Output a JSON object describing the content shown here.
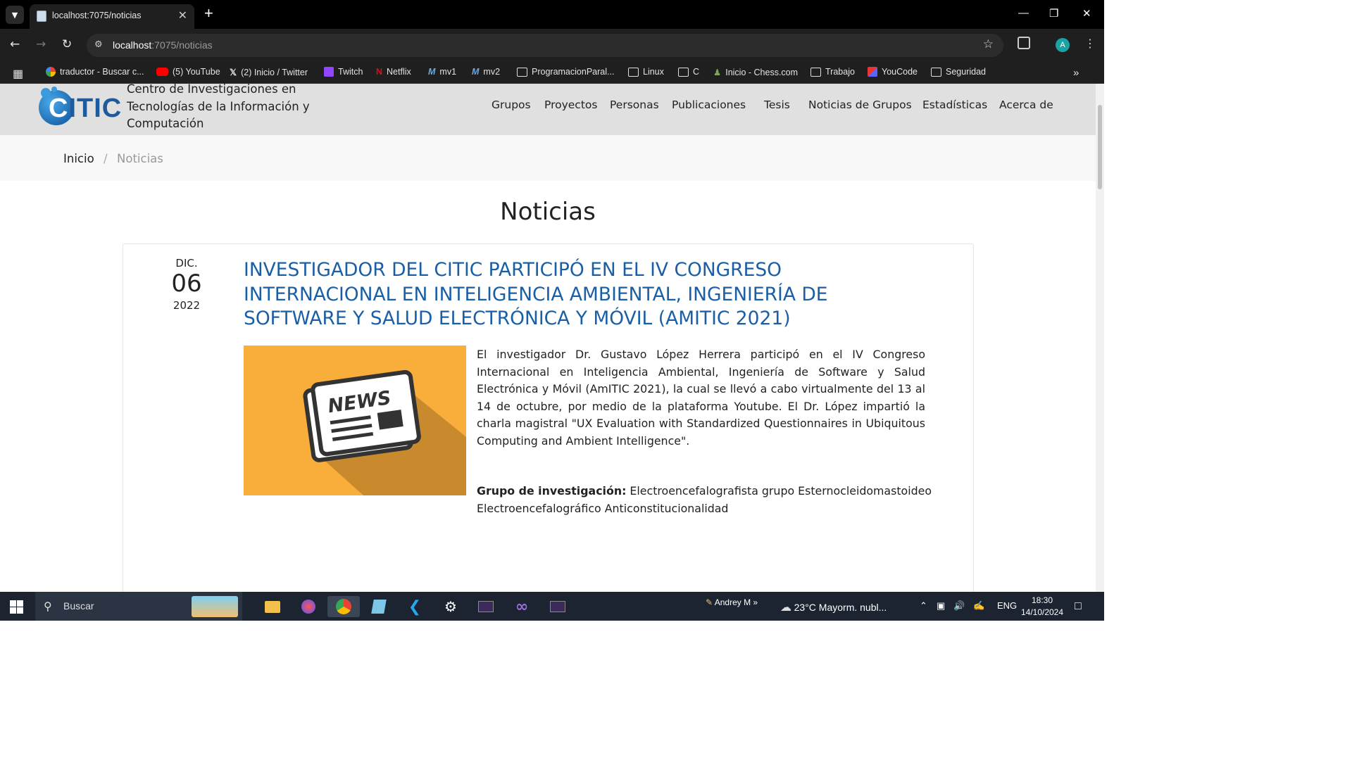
{
  "browser": {
    "tab_title": "localhost:7075/noticias",
    "url_host": "localhost",
    "url_rest": ":7075/noticias",
    "profile_initial": "A",
    "bookmarks": [
      {
        "label": "traductor - Buscar c...",
        "icon": "google-icon"
      },
      {
        "label": "(5) YouTube",
        "icon": "youtube-icon"
      },
      {
        "label": "(2) Inicio / Twitter",
        "icon": "x-icon"
      },
      {
        "label": "Twitch",
        "icon": "twitch-icon"
      },
      {
        "label": "Netflix",
        "icon": "netflix-icon"
      },
      {
        "label": "mv1",
        "icon": "m-icon"
      },
      {
        "label": "mv2",
        "icon": "m-icon"
      },
      {
        "label": "ProgramacionParal...",
        "icon": "folder-icon"
      },
      {
        "label": "Linux",
        "icon": "folder-icon"
      },
      {
        "label": "C",
        "icon": "folder-icon"
      },
      {
        "label": "Inicio - Chess.com",
        "icon": "chess-icon"
      },
      {
        "label": "Trabajo",
        "icon": "folder-icon"
      },
      {
        "label": "YouCode",
        "icon": "youcode-icon"
      },
      {
        "label": "Seguridad",
        "icon": "folder-icon"
      }
    ]
  },
  "site": {
    "logo_text_first": "C",
    "logo_text_rest": "ITIC",
    "org_name": "Centro de Investigaciones en Tecnologías de la Información y Computación",
    "menu": [
      "Grupos",
      "Proyectos",
      "Personas",
      "Publicaciones",
      "Tesis",
      "Noticias de Grupos",
      "Estadísticas",
      "Acerca de"
    ],
    "breadcrumb": {
      "home": "Inicio",
      "separator": "/",
      "current": "Noticias"
    },
    "page_title": "Noticias"
  },
  "news": {
    "month": "DIC.",
    "day": "06",
    "year": "2022",
    "title": "Investigador del CITIC participó en el IV Congreso Internacional en Inteligencia Ambiental, Ingeniería de Software y Salud Electrónica y Móvil (AmITIC 2021)",
    "image_label": "NEWS",
    "body": "El investigador Dr. Gustavo López Herrera participó en el IV Congreso Internacional en Inteligencia Ambiental, Ingeniería de Software y Salud Electrónica y Móvil (AmITIC 2021), la cual se llevó a cabo virtualmente del 13 al 14 de octubre, por medio de la plataforma Youtube. El Dr. López impartió la charla magistral \"UX Evaluation with Standardized Questionnaires in Ubiquitous Computing and Ambient Intelligence\".",
    "group_label": "Grupo de investigación:",
    "group_value": "Electroencefalografista grupo Esternocleidomastoideo Electroencefalográfico Anticonstitucionalidad"
  },
  "taskbar": {
    "search_placeholder": "Buscar",
    "user": "Andrey M",
    "weather": "23°C  Mayorm. nubl...",
    "lang": "ENG",
    "time": "18:30",
    "date": "14/10/2024"
  }
}
